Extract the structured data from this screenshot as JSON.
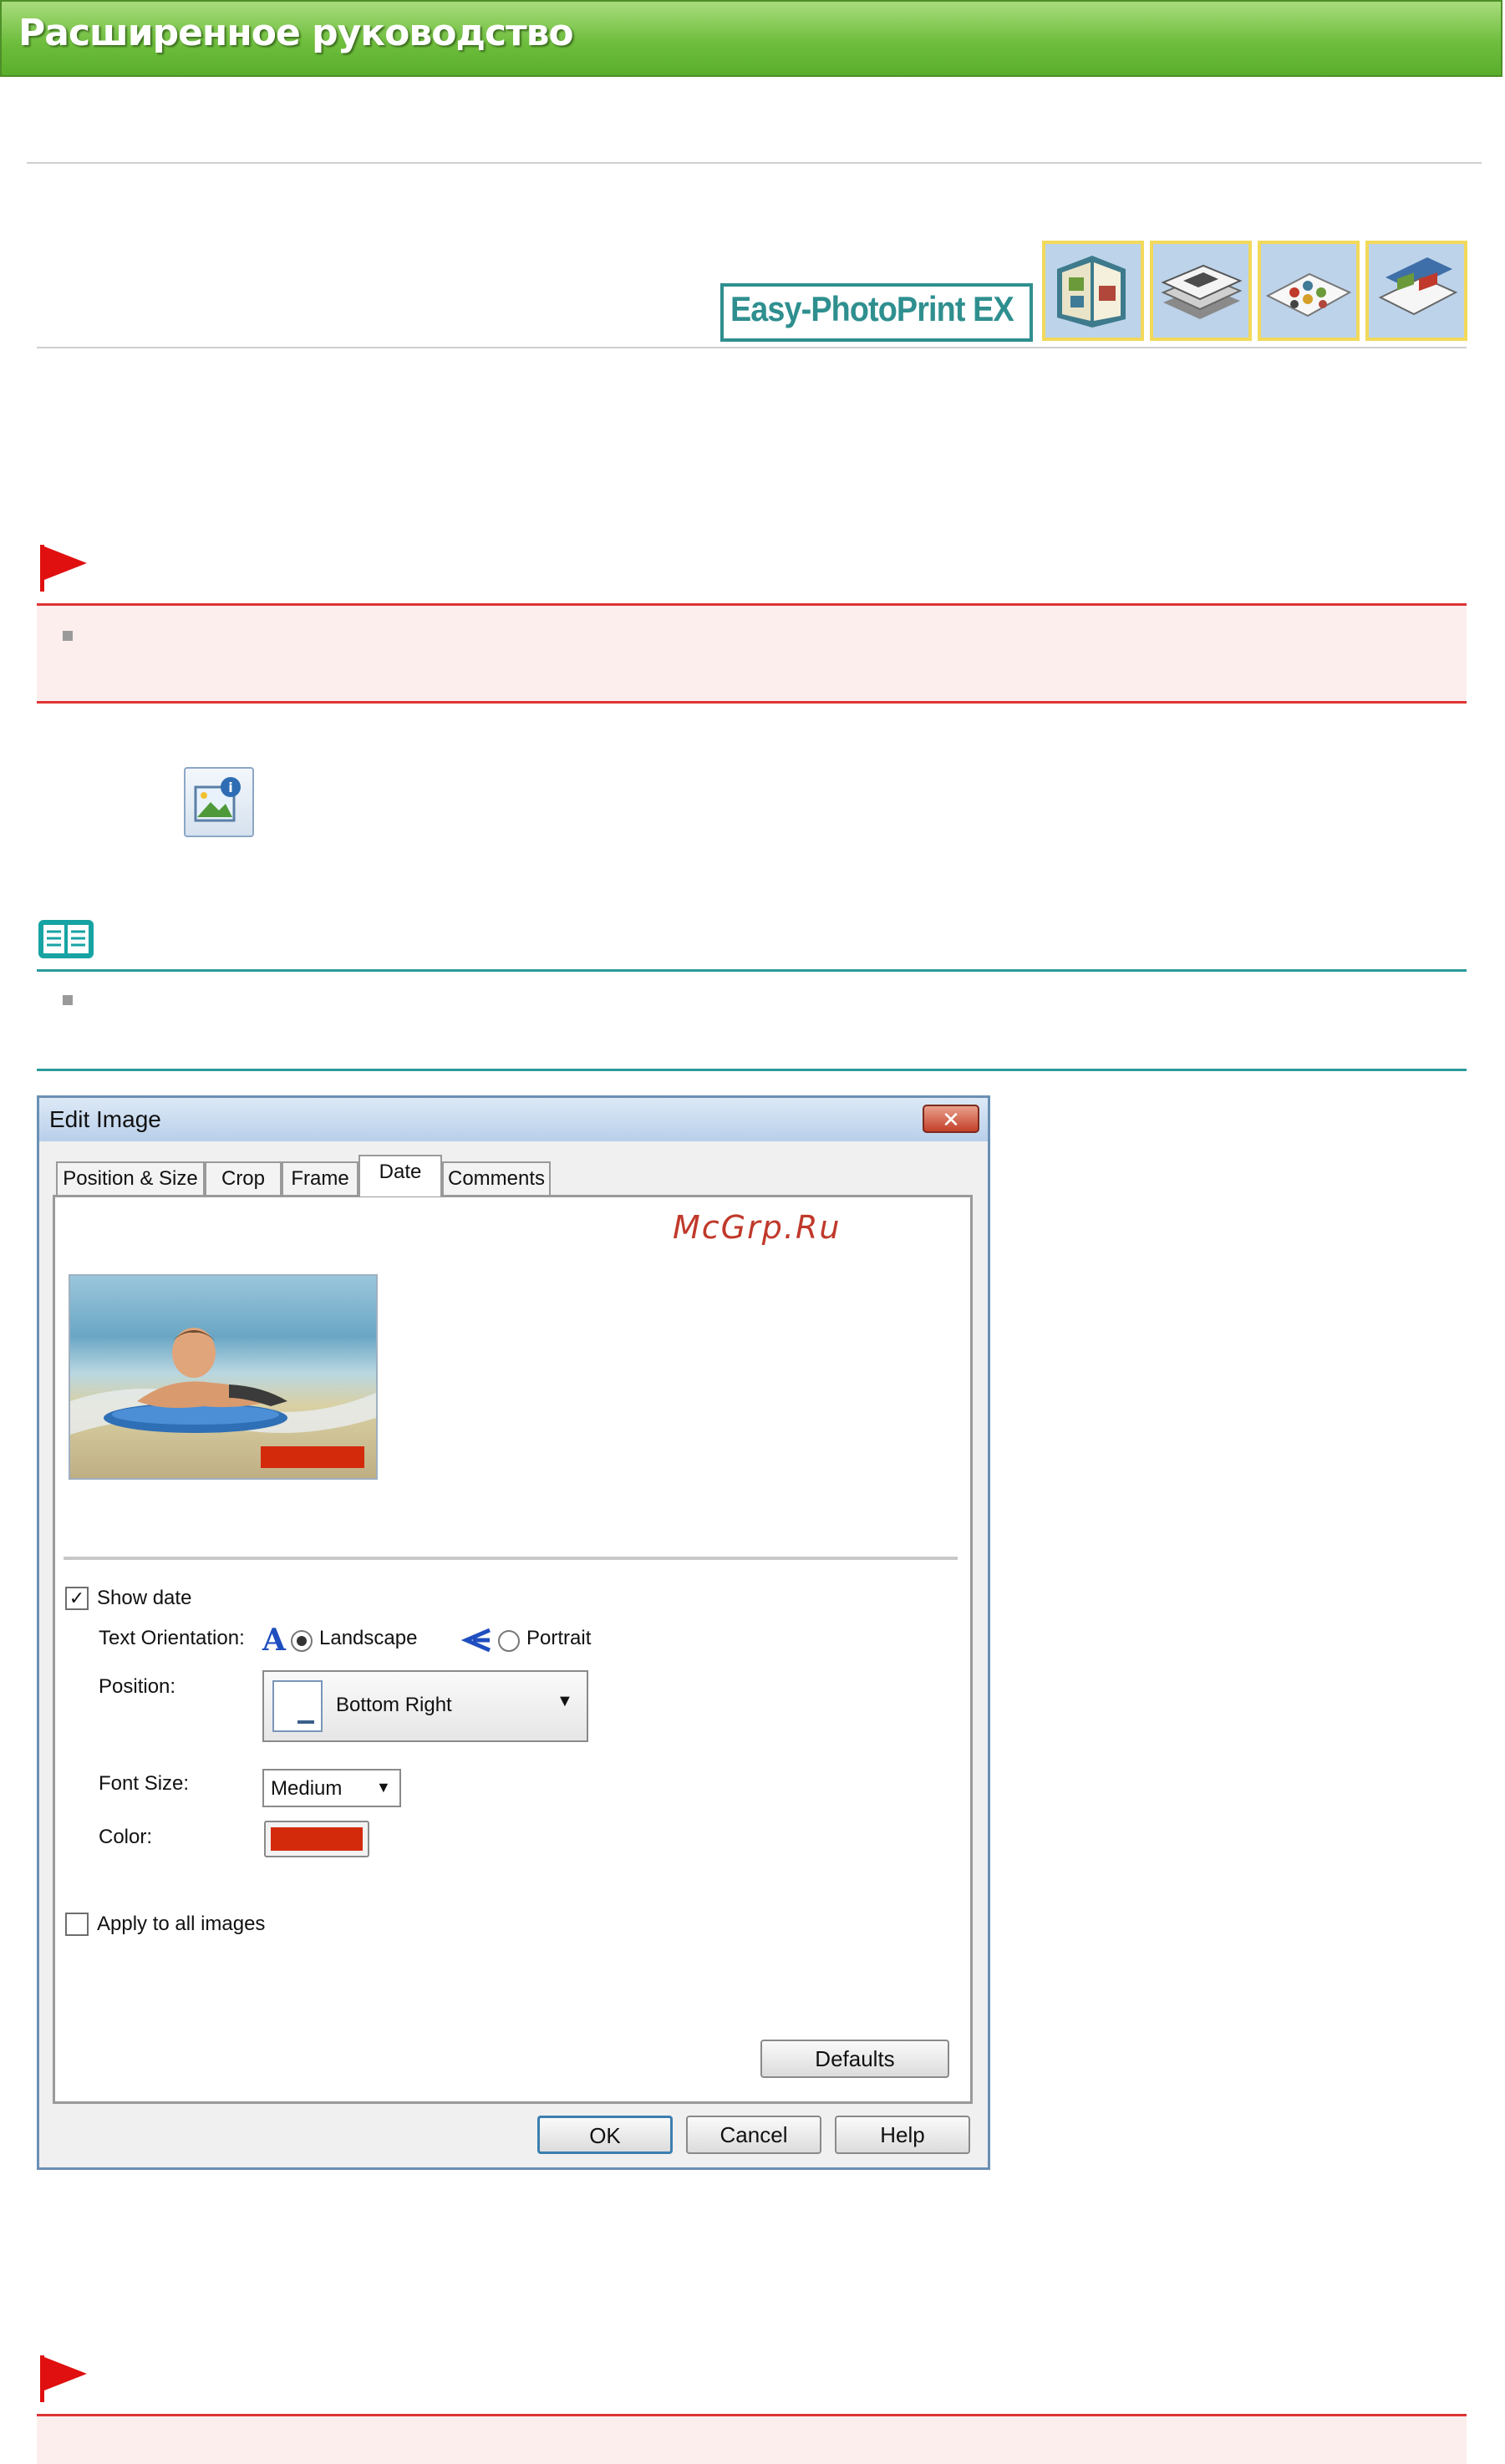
{
  "header": {
    "title": "Расширенное руководство"
  },
  "product": {
    "logo_text": "Easy-PhotoPrint EX",
    "mode_icons": [
      "album-icon",
      "calendar-icon",
      "stickers-icon",
      "layout-print-icon"
    ]
  },
  "watermark": "McGrp.Ru",
  "dialog": {
    "title": "Edit Image",
    "close_symbol": "✕",
    "tabs": [
      "Position & Size",
      "Crop",
      "Frame",
      "Date",
      "Comments"
    ],
    "active_tab": "Date",
    "show_date_label": "Show date",
    "show_date_checked": true,
    "text_orientation_label": "Text Orientation:",
    "landscape_label": "Landscape",
    "portrait_label": "Portrait",
    "orientation_selected": "Landscape",
    "position_label": "Position:",
    "position_value": "Bottom Right",
    "font_size_label": "Font Size:",
    "font_size_value": "Medium",
    "color_label": "Color:",
    "date_color": "#d42a0c",
    "apply_all_label": "Apply to all images",
    "apply_all_checked": false,
    "defaults_button": "Defaults",
    "ok_button": "OK",
    "cancel_button": "Cancel",
    "help_button": "Help"
  },
  "colors": {
    "banner_green": "#6fbe3e",
    "caution_red": "#dd3333",
    "note_teal": "#2b9a9a",
    "logo_teal": "#2f8f8f"
  }
}
